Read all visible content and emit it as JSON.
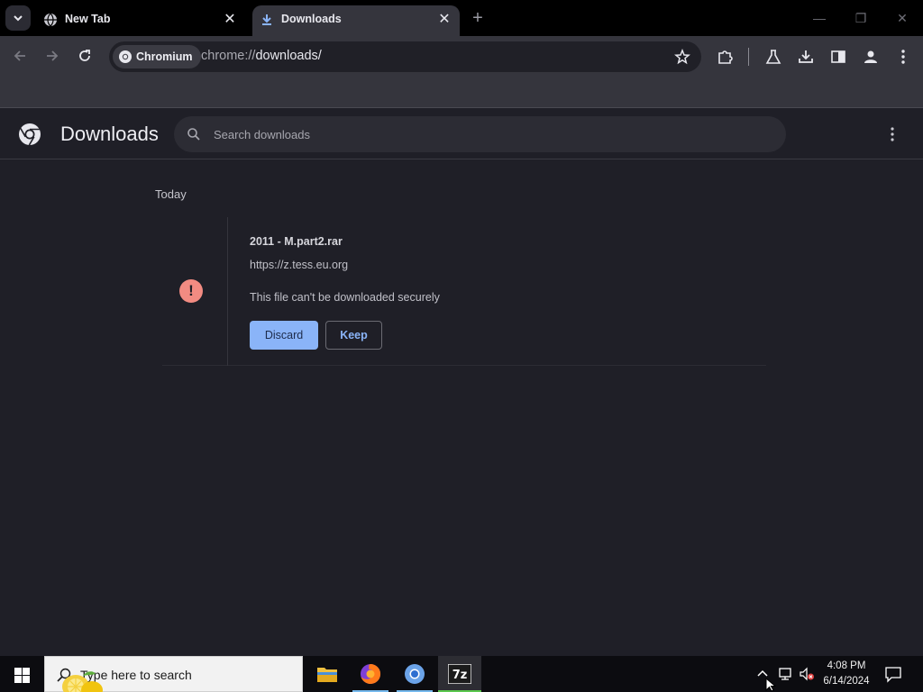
{
  "browser": {
    "tabs": [
      {
        "title": "New Tab",
        "active": false
      },
      {
        "title": "Downloads",
        "active": true
      }
    ],
    "omnibox": {
      "chip_label": "Chromium",
      "url_scheme": "chrome://",
      "url_path": "downloads/"
    }
  },
  "downloads_page": {
    "title": "Downloads",
    "search_placeholder": "Search downloads",
    "date_group": "Today",
    "item": {
      "file_name": "2011 - M.part2.rar",
      "source_url": "https://z.tess.eu.org",
      "status": "This file can't be downloaded securely",
      "warning_glyph": "!",
      "discard_label": "Discard",
      "keep_label": "Keep"
    }
  },
  "taskbar": {
    "search_placeholder": "Type here to search",
    "apps": [
      "file-explorer",
      "firefox",
      "chromium",
      "7-zip"
    ],
    "clock_time": "4:08 PM",
    "clock_date": "6/14/2024"
  },
  "colors": {
    "page_bg": "#1f1f27",
    "toolbar_bg": "#35353d",
    "accent_blue": "#8ab4f8",
    "warning_red": "#f28b82"
  }
}
